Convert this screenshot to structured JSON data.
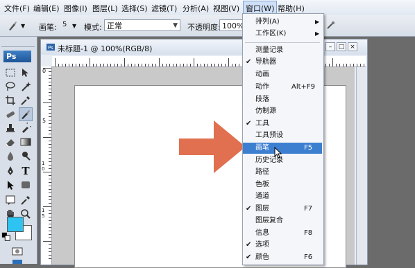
{
  "menubar": {
    "items": [
      "文件(F)",
      "编辑(E)",
      "图像(I)",
      "图层(L)",
      "选择(S)",
      "滤镜(T)",
      "分析(A)",
      "视图(V)",
      "窗口(W)",
      "帮助(H)"
    ],
    "active_index": 8
  },
  "options": {
    "brush_label": "画笔:",
    "brush_size": "5",
    "mode_label": "模式:",
    "mode_value": "正常",
    "opacity_label": "不透明度:",
    "opacity_value": "100%"
  },
  "tools": {
    "logo": "Ps",
    "type_glyph": "T",
    "foreground_color": "#2ec3f0",
    "background_color": "#ffffff"
  },
  "document": {
    "title": "未标题-1 @ 100%(RGB/8)",
    "ruler_left_marks": [
      "0",
      "5",
      "1 0",
      "1 5"
    ]
  },
  "window_menu": {
    "items": [
      {
        "label": "排列(A)",
        "submenu": true
      },
      {
        "label": "工作区(K)",
        "submenu": true
      },
      {
        "label": "测量记录"
      },
      {
        "label": "导航器",
        "checked": true
      },
      {
        "label": "动画"
      },
      {
        "label": "动作",
        "shortcut": "Alt+F9"
      },
      {
        "label": "段落"
      },
      {
        "label": "仿制源"
      },
      {
        "label": "工具",
        "checked": true
      },
      {
        "label": "工具预设"
      },
      {
        "label": "画笔",
        "shortcut": "F5",
        "highlighted": true
      },
      {
        "label": "历史记录"
      },
      {
        "label": "路径"
      },
      {
        "label": "色板"
      },
      {
        "label": "通道"
      },
      {
        "label": "图层",
        "shortcut": "F7",
        "checked": true
      },
      {
        "label": "图层复合"
      },
      {
        "label": "信息",
        "shortcut": "F8"
      },
      {
        "label": "选项",
        "checked": true
      },
      {
        "label": "颜色",
        "shortcut": "F6",
        "checked": true
      }
    ]
  },
  "annotation": {
    "arrow_color": "#e0704f"
  }
}
